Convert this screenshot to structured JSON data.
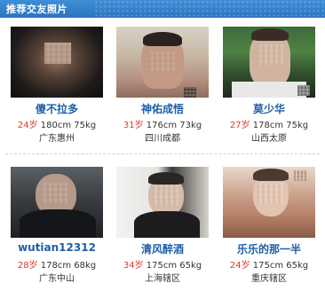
{
  "header": {
    "title": "推荐交友照片"
  },
  "profiles": [
    {
      "name": "傻不拉多",
      "age": "24岁",
      "stats": " 180cm 75kg",
      "location": "广东惠州"
    },
    {
      "name": "神佑成悟",
      "age": "31岁",
      "stats": " 176cm 73kg",
      "location": "四川成都"
    },
    {
      "name": "莫少华",
      "age": "27岁",
      "stats": " 178cm 75kg",
      "location": "山西太原"
    },
    {
      "name": "wutian12312",
      "age": "28岁",
      "stats": " 178cm 68kg",
      "location": "广东中山"
    },
    {
      "name": "清风醉酒",
      "age": "34岁",
      "stats": " 175cm 65kg",
      "location": "上海辖区"
    },
    {
      "name": "乐乐的那一半",
      "age": "24岁",
      "stats": " 175cm 65kg",
      "location": "重庆辖区"
    }
  ]
}
